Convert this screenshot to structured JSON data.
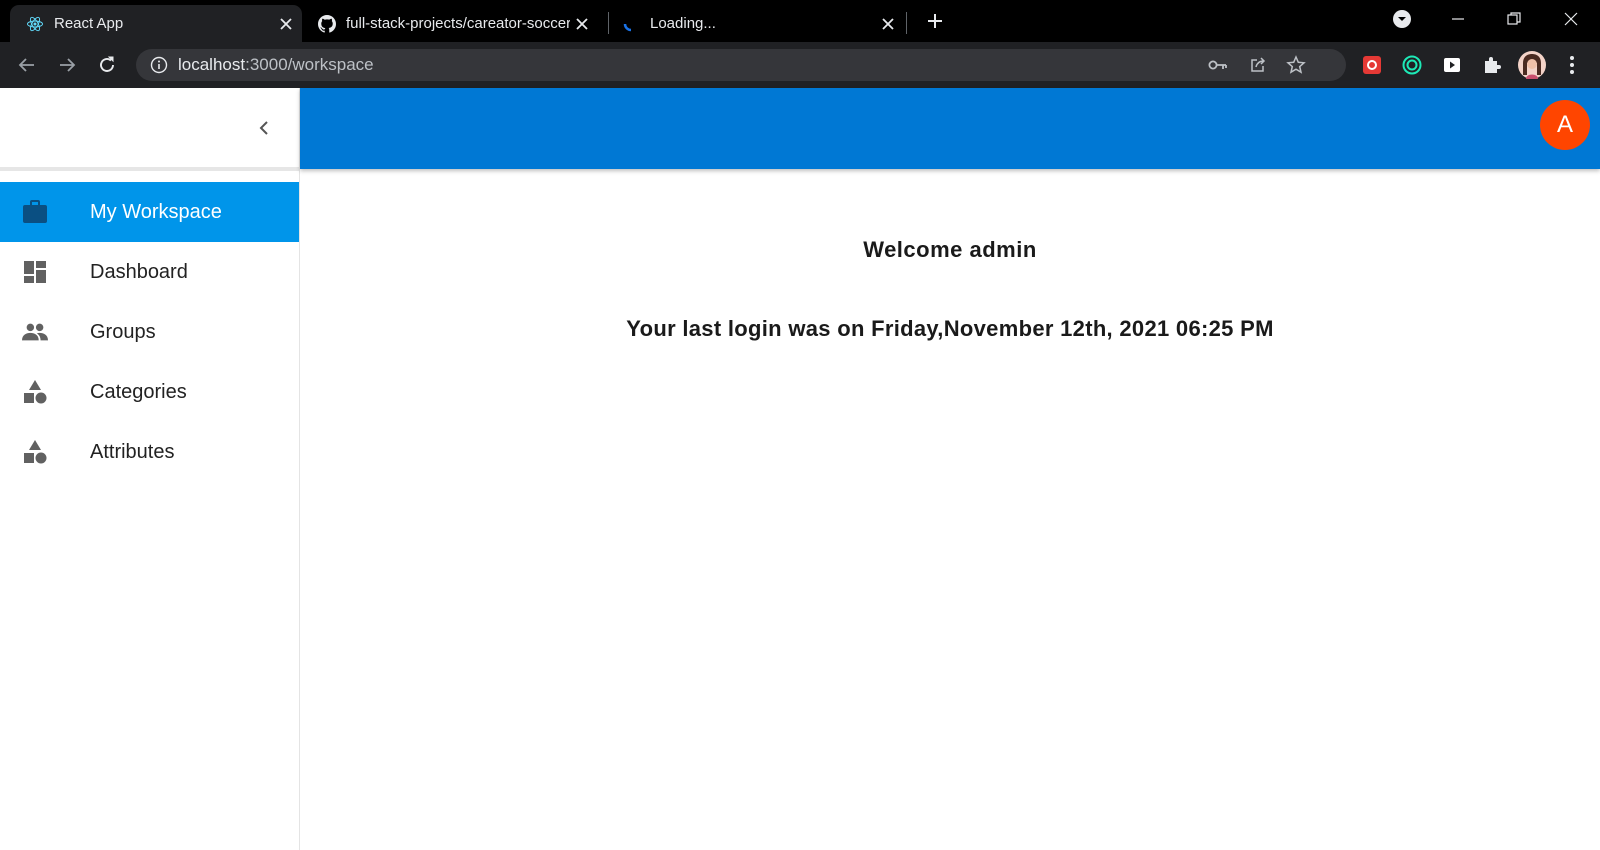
{
  "browser": {
    "tabs": [
      {
        "title": "React App",
        "favicon": "react-icon",
        "active": true
      },
      {
        "title": "full-stack-projects/careator-soccer",
        "favicon": "github-icon",
        "active": false
      },
      {
        "title": "Loading...",
        "favicon": "loading-spinner-icon",
        "active": false
      }
    ],
    "url": {
      "host": "localhost",
      "path": ":3000/workspace"
    }
  },
  "sidebar": {
    "items": [
      {
        "label": "My Workspace",
        "icon": "briefcase-icon",
        "active": true
      },
      {
        "label": "Dashboard",
        "icon": "dashboard-icon",
        "active": false
      },
      {
        "label": "Groups",
        "icon": "people-icon",
        "active": false
      },
      {
        "label": "Categories",
        "icon": "category-icon",
        "active": false
      },
      {
        "label": "Attributes",
        "icon": "category-icon",
        "active": false
      }
    ]
  },
  "appbar": {
    "avatar_letter": "A",
    "color": "#0078d4",
    "avatar_color": "#ff4500"
  },
  "main": {
    "welcome": "Welcome admin",
    "last_login": "Your last login was on Friday,November 12th, 2021 06:25 PM"
  },
  "colors": {
    "active_nav": "#0095ea"
  }
}
